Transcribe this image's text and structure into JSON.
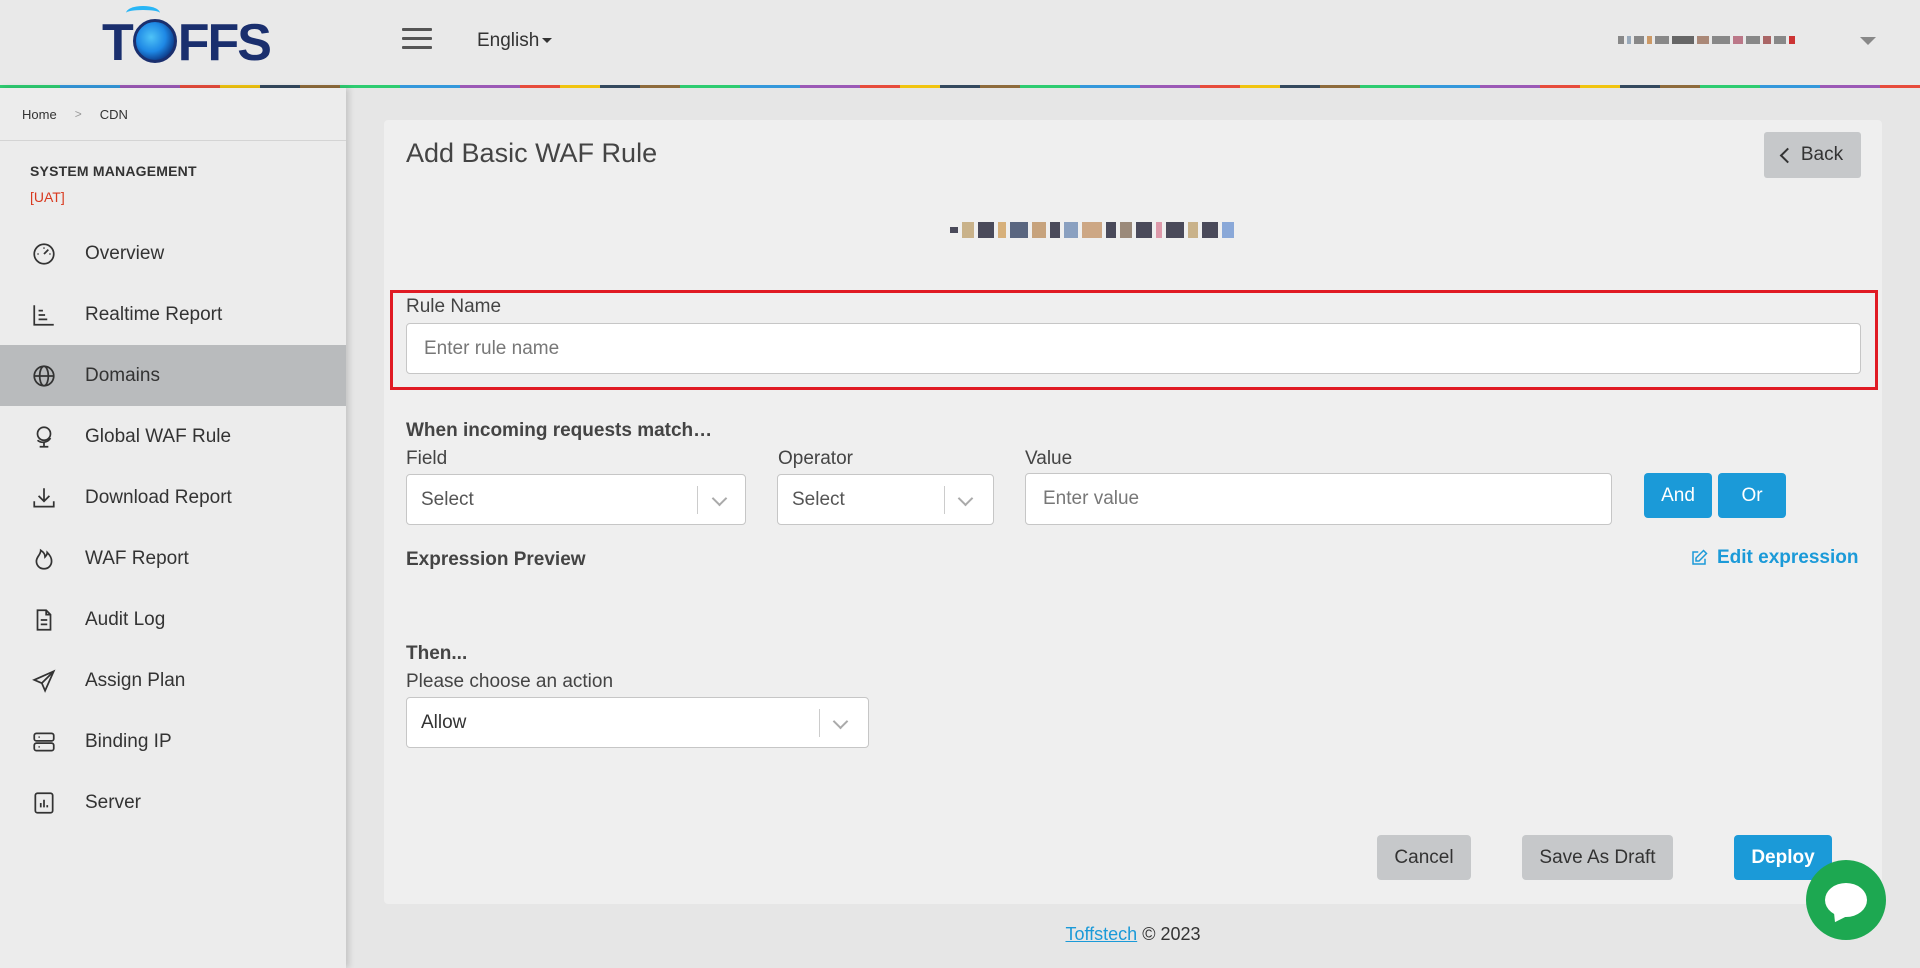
{
  "header": {
    "logo_text_left": "T",
    "logo_text_right": "FFS",
    "language": "English"
  },
  "breadcrumb": {
    "home": "Home",
    "current": "CDN"
  },
  "sidebar": {
    "section_title": "SYSTEM MANAGEMENT",
    "environment": "[UAT]",
    "items": [
      {
        "label": "Overview",
        "icon": "speedometer-icon",
        "active": false
      },
      {
        "label": "Realtime Report",
        "icon": "bar-chart-icon",
        "active": false
      },
      {
        "label": "Domains",
        "icon": "globe-icon",
        "active": true
      },
      {
        "label": "Global WAF Rule",
        "icon": "globe-stand-icon",
        "active": false
      },
      {
        "label": "Download Report",
        "icon": "download-icon",
        "active": false
      },
      {
        "label": "WAF Report",
        "icon": "fire-icon",
        "active": false
      },
      {
        "label": "Audit Log",
        "icon": "document-icon",
        "active": false
      },
      {
        "label": "Assign Plan",
        "icon": "send-icon",
        "active": false
      },
      {
        "label": "Binding IP",
        "icon": "server-icon",
        "active": false
      },
      {
        "label": "Server",
        "icon": "stats-icon",
        "active": false
      }
    ]
  },
  "page": {
    "title": "Add Basic WAF Rule",
    "back_label": "Back",
    "rule_name": {
      "label": "Rule Name",
      "placeholder": "Enter rule name"
    },
    "match_heading": "When incoming requests match…",
    "field": {
      "label": "Field",
      "value": "Select"
    },
    "operator": {
      "label": "Operator",
      "value": "Select"
    },
    "value": {
      "label": "Value",
      "placeholder": "Enter value"
    },
    "and_label": "And",
    "or_label": "Or",
    "expression_preview": "Expression Preview",
    "edit_expression": "Edit expression",
    "then_heading": "Then...",
    "action": {
      "label": "Please choose an action",
      "value": "Allow"
    },
    "cancel_label": "Cancel",
    "draft_label": "Save As Draft",
    "deploy_label": "Deploy"
  },
  "footer": {
    "link": "Toffstech",
    "text": " © 2023"
  },
  "colors": {
    "accent": "#1b9ad8",
    "highlight": "#e01b24",
    "env": "#d9391f",
    "chat": "#1da851"
  }
}
